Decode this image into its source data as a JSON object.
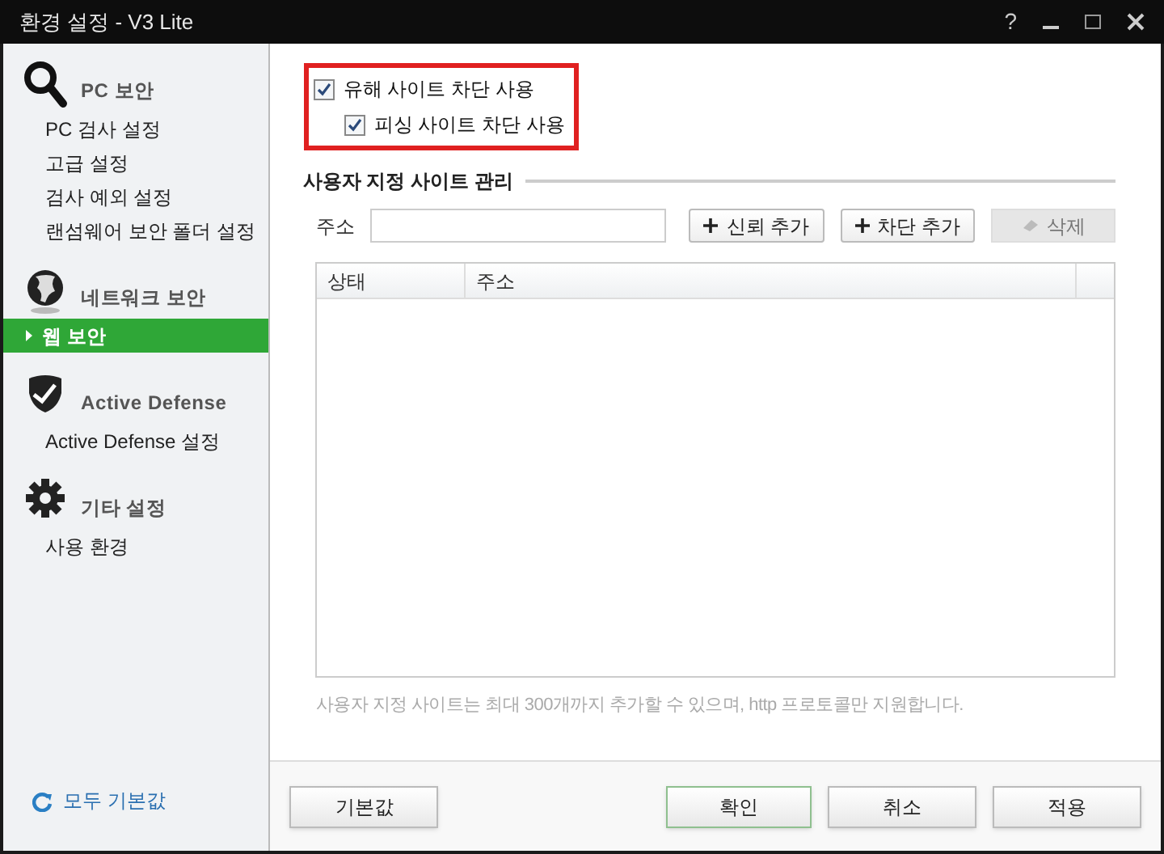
{
  "window": {
    "title": "환경 설정 - V3 Lite",
    "controls": [
      "?"
    ]
  },
  "sidebar": {
    "sections": [
      {
        "title": "PC 보안",
        "items": [
          {
            "label": "PC 검사 설정",
            "selected": false
          },
          {
            "label": "고급 설정",
            "selected": false
          },
          {
            "label": "검사 예외 설정",
            "selected": false
          },
          {
            "label": "랜섬웨어 보안 폴더 설정",
            "selected": false
          }
        ]
      },
      {
        "title": "네트워크 보안",
        "items": [
          {
            "label": "웹 보안",
            "selected": true
          }
        ]
      },
      {
        "title": "Active Defense",
        "items": [
          {
            "label": "Active Defense 설정",
            "selected": false
          }
        ]
      },
      {
        "title": "기타 설정",
        "items": [
          {
            "label": "사용 환경",
            "selected": false
          }
        ]
      }
    ],
    "reset_link": "모두 기본값"
  },
  "options": {
    "highlighted": true,
    "checkboxes": [
      {
        "label": "유해 사이트 차단 사용",
        "checked": true
      },
      {
        "label": "피싱 사이트 차단 사용",
        "checked": true
      }
    ]
  },
  "site_management": {
    "title": "사용자 지정 사이트 관리",
    "address_label": "주소",
    "buttons": [
      {
        "label": "신뢰 추가",
        "disabled": false
      },
      {
        "label": "차단 추가",
        "disabled": false
      },
      {
        "label": "삭제",
        "disabled": true
      }
    ],
    "table": {
      "columns": [
        "상태",
        "주소"
      ]
    },
    "note": "사용자 지정 사이트는 최대 300개까지 추가할 수 있으며, http 프로토콜만 지원합니다."
  },
  "footer": {
    "left_button": "기본값",
    "buttons": [
      {
        "label": "확인",
        "primary": true
      },
      {
        "label": "취소",
        "primary": false
      },
      {
        "label": "적용",
        "primary": false
      }
    ]
  }
}
